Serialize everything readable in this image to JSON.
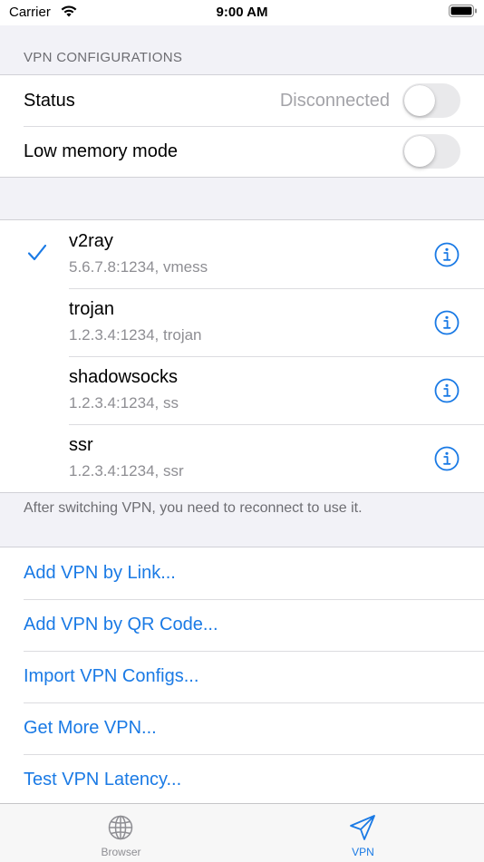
{
  "status_bar": {
    "carrier": "Carrier",
    "time": "9:00 AM"
  },
  "config_section": {
    "header": "VPN CONFIGURATIONS",
    "status_label": "Status",
    "status_value": "Disconnected",
    "status_on": false,
    "low_memory_label": "Low memory mode",
    "low_memory_on": false
  },
  "vpn_list": [
    {
      "name": "v2ray",
      "detail": "5.6.7.8:1234, vmess",
      "selected": true
    },
    {
      "name": "trojan",
      "detail": "1.2.3.4:1234, trojan",
      "selected": false
    },
    {
      "name": "shadowsocks",
      "detail": "1.2.3.4:1234, ss",
      "selected": false
    },
    {
      "name": "ssr",
      "detail": "1.2.3.4:1234, ssr",
      "selected": false
    }
  ],
  "vpn_footer": "After switching VPN, you need to reconnect to use it.",
  "actions": [
    {
      "label": "Add VPN by Link..."
    },
    {
      "label": "Add VPN by QR Code..."
    },
    {
      "label": "Import VPN Configs..."
    },
    {
      "label": "Get More VPN..."
    },
    {
      "label": "Test VPN Latency..."
    }
  ],
  "tabbar": {
    "tabs": [
      {
        "label": "Browser",
        "icon": "globe-icon",
        "active": false
      },
      {
        "label": "VPN",
        "icon": "paper-plane-icon",
        "active": true
      }
    ]
  },
  "colors": {
    "accent": "#1a7ae5",
    "inactive_tab": "#8e8e93",
    "secondary_text": "#8e8e93",
    "background": "#f2f2f7"
  }
}
